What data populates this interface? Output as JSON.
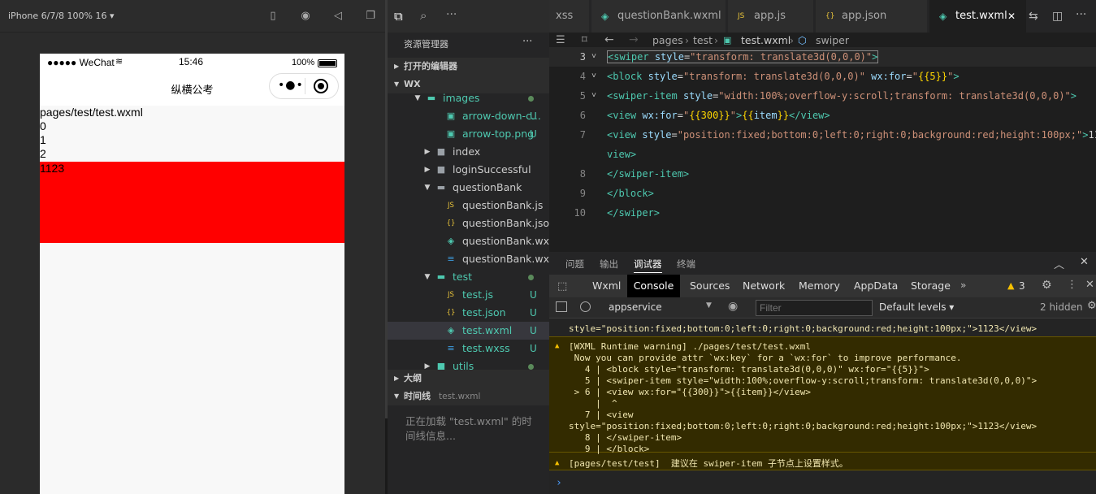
{
  "simulator": {
    "device_label": "iPhone 6/7/8 100% 16 ▾",
    "status": {
      "signal": "●●●●● WeChat",
      "time": "15:46",
      "battery": "100%"
    },
    "nav_title": "纵横公考",
    "content_lines": [
      "pages/test/test.wxml",
      "0",
      "1",
      "2"
    ],
    "red_bar_text": "1123"
  },
  "explorer": {
    "title": "资源管理器",
    "more": "···",
    "open_editors": "打开的编辑器",
    "root": "WX",
    "items": [
      {
        "label": "images",
        "indent": 1,
        "type": "folder-open",
        "color": "#4ec9b0",
        "status": "dot"
      },
      {
        "label": "arrow-down-c...",
        "indent": 3,
        "type": "image",
        "color": "#4ec9b0",
        "status": "U"
      },
      {
        "label": "arrow-top.png",
        "indent": 3,
        "type": "image",
        "color": "#4ec9b0",
        "status": "U"
      },
      {
        "label": "index",
        "indent": 2,
        "type": "folder",
        "color": "#ccc",
        "status": ""
      },
      {
        "label": "loginSuccessful",
        "indent": 2,
        "type": "folder",
        "color": "#ccc",
        "status": ""
      },
      {
        "label": "questionBank",
        "indent": 2,
        "type": "folder-open",
        "color": "#ccc",
        "status": ""
      },
      {
        "label": "questionBank.js",
        "indent": 3,
        "type": "js",
        "color": "#ccc",
        "status": ""
      },
      {
        "label": "questionBank.json",
        "indent": 3,
        "type": "json",
        "color": "#ccc",
        "status": ""
      },
      {
        "label": "questionBank.wxml",
        "indent": 3,
        "type": "wxml",
        "color": "#ccc",
        "status": ""
      },
      {
        "label": "questionBank.wxss",
        "indent": 3,
        "type": "wxss",
        "color": "#ccc",
        "status": ""
      },
      {
        "label": "test",
        "indent": 2,
        "type": "folder-open",
        "color": "#4ec9b0",
        "status": "dot"
      },
      {
        "label": "test.js",
        "indent": 3,
        "type": "js",
        "color": "#4ec9b0",
        "status": "U"
      },
      {
        "label": "test.json",
        "indent": 3,
        "type": "json",
        "color": "#4ec9b0",
        "status": "U"
      },
      {
        "label": "test.wxml",
        "indent": 3,
        "type": "wxml",
        "color": "#4ec9b0",
        "status": "U",
        "selected": true
      },
      {
        "label": "test.wxss",
        "indent": 3,
        "type": "wxss",
        "color": "#4ec9b0",
        "status": "U"
      },
      {
        "label": "utils",
        "indent": 2,
        "type": "folder",
        "color": "#4ec9b0",
        "status": "dot"
      }
    ],
    "outline": "大纲",
    "timeline": "时间线",
    "timeline_file": "test.wxml",
    "timeline_loading": "正在加载 \"test.wxml\" 的时间线信息..."
  },
  "editor": {
    "tabs": [
      {
        "label": "xss",
        "icon": ""
      },
      {
        "label": "questionBank.wxml",
        "icon": "wxml"
      },
      {
        "label": "app.js",
        "icon": "js"
      },
      {
        "label": "app.json",
        "icon": "json"
      },
      {
        "label": "test.wxml",
        "icon": "wxml",
        "active": true
      }
    ],
    "breadcrumb": [
      "pages",
      "test",
      "test.wxml",
      "swiper"
    ],
    "lines": [
      {
        "n": "3",
        "fold": "˅"
      },
      {
        "n": "4",
        "fold": "˅"
      },
      {
        "n": "5",
        "fold": "˅"
      },
      {
        "n": "6",
        "fold": ""
      },
      {
        "n": "7",
        "fold": ""
      },
      {
        "n": "",
        "fold": ""
      },
      {
        "n": "8",
        "fold": ""
      },
      {
        "n": "9",
        "fold": ""
      },
      {
        "n": "10",
        "fold": ""
      }
    ]
  },
  "debug": {
    "panel_tabs": [
      "问题",
      "输出",
      "调试器",
      "终端"
    ],
    "devtools_tabs": [
      "Wxml",
      "Console",
      "Sources",
      "Network",
      "Memory",
      "AppData",
      "Storage"
    ],
    "warn_count": "3",
    "context": "appservice",
    "filter_placeholder": "Filter",
    "levels": "Default levels ▾",
    "hidden": "2 hidden",
    "console_lines": [
      "style=\"position:fixed;bottom:0;left:0;right:0;background:red;height:100px;\">1123</view>",
      "[WXML Runtime warning] ./pages/test/test.wxml",
      " Now you can provide attr `wx:key` for a `wx:for` to improve performance.",
      "   4 | <block style=\"transform: translate3d(0,0,0)\" wx:for=\"{{5}}\">",
      "   5 | <swiper-item style=\"width:100%;overflow-y:scroll;transform: translate3d(0,0,0)\">",
      " > 6 | <view wx:for=\"{{300}}\">{{item}}</view>",
      "     |  ^",
      "   7 | <view",
      "style=\"position:fixed;bottom:0;left:0;right:0;background:red;height:100px;\">1123</view>",
      "   8 | </swiper-item>",
      "   9 | </block>",
      "[pages/test/test]  建议在 swiper-item 子节点上设置样式。"
    ],
    "prompt": "›"
  }
}
